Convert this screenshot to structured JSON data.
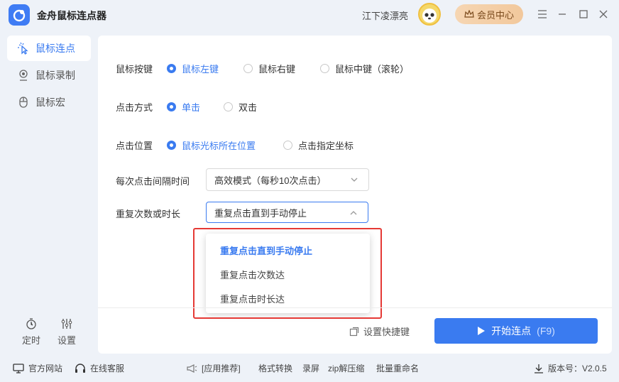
{
  "app": {
    "title": "金舟鼠标连点器",
    "username": "江下凌漂亮",
    "vip_label": "会员中心"
  },
  "sidebar": {
    "items": [
      {
        "label": "鼠标连点",
        "icon": "cursor-click-icon"
      },
      {
        "label": "鼠标录制",
        "icon": "record-icon"
      },
      {
        "label": "鼠标宏",
        "icon": "mouse-icon"
      }
    ],
    "timer_label": "定时",
    "settings_label": "设置"
  },
  "form": {
    "mouse_button": {
      "label": "鼠标按键",
      "options": [
        "鼠标左键",
        "鼠标右键",
        "鼠标中键（滚轮）"
      ],
      "selected": 0
    },
    "click_type": {
      "label": "点击方式",
      "options": [
        "单击",
        "双击"
      ],
      "selected": 0
    },
    "click_position": {
      "label": "点击位置",
      "options": [
        "鼠标光标所在位置",
        "点击指定坐标"
      ],
      "selected": 0
    },
    "interval": {
      "label": "每次点击间隔时间",
      "value": "高效模式（每秒10次点击）"
    },
    "repeat": {
      "label": "重复次数或时长",
      "value": "重复点击直到手动停止",
      "options": [
        "重复点击直到手动停止",
        "重复点击次数达",
        "重复点击时长达"
      ]
    }
  },
  "actions": {
    "shortcut_label": "设置快捷键",
    "start_label": "开始连点",
    "start_hotkey": "(F9)"
  },
  "footer": {
    "website": "官方网站",
    "support": "在线客服",
    "promo_tag": "[应用推荐]",
    "promos": [
      "格式转换",
      "录屏",
      "zip解压缩",
      "批量重命名"
    ],
    "version": "版本号：V2.0.5"
  },
  "colors": {
    "accent": "#3a7bf0",
    "highlight": "#e53935",
    "vip": "#f2c89c"
  }
}
